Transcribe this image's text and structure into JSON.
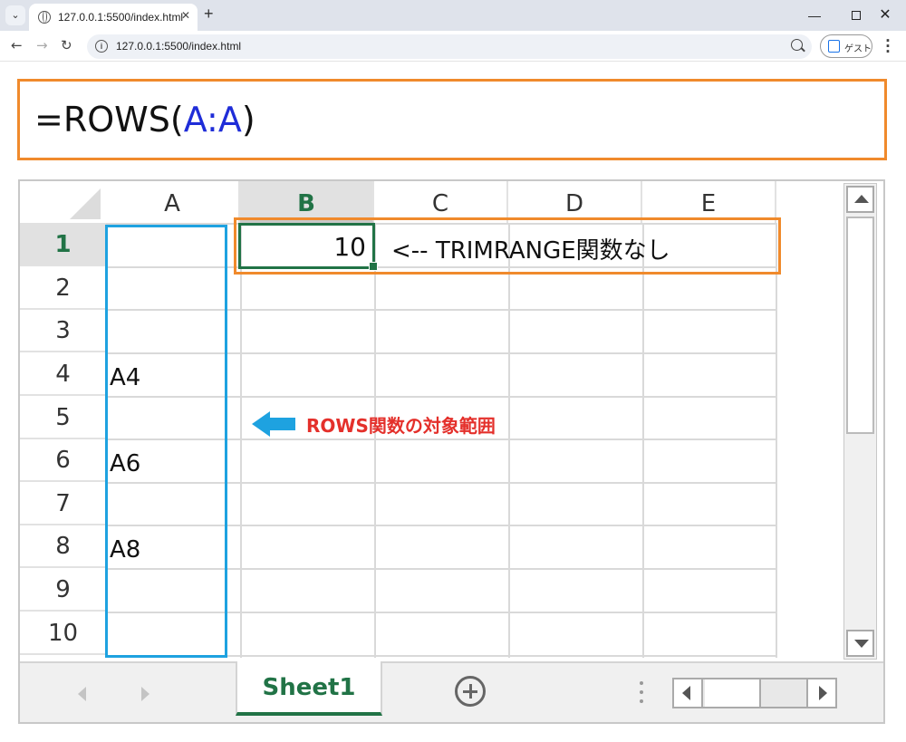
{
  "browser": {
    "tab_title": "127.0.0.1:5500/index.html",
    "url": "127.0.0.1:5500/index.html",
    "guest_label": "ゲスト"
  },
  "formula_bar": {
    "prefix": "=ROWS(",
    "range_ref": "A:A",
    "suffix": ")"
  },
  "sheet": {
    "columns": [
      "A",
      "B",
      "C",
      "D",
      "E"
    ],
    "active_column": "B",
    "rows": [
      "1",
      "2",
      "3",
      "4",
      "5",
      "6",
      "7",
      "8",
      "9",
      "10"
    ],
    "active_row": "1",
    "cells": {
      "A4": "A4",
      "A6": "A6",
      "A8": "A8",
      "B1": "10",
      "C1": "<-- TRIMRANGE関数なし"
    },
    "range_annotation": "ROWS関数の対象範囲",
    "tab_name": "Sheet1"
  },
  "colors": {
    "accent_green": "#217346",
    "highlight_orange": "#f08a2c",
    "range_blue": "#1ea2e0",
    "annotation_red": "#e4302b",
    "reference_blue": "#1f2dd8"
  }
}
